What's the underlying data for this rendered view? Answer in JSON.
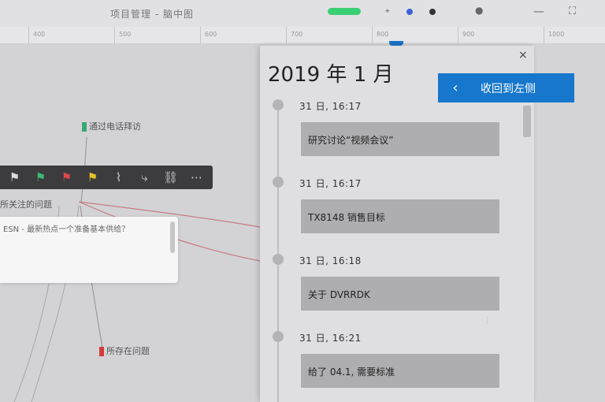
{
  "window": {
    "title": "项目管理 - 脑中图",
    "status_color": "#3bcf73",
    "controls": [
      "minimize",
      "restore"
    ]
  },
  "ruler": {
    "labels": [
      "400",
      "500",
      "600",
      "700",
      "800",
      "900",
      "1000"
    ]
  },
  "mindmap": {
    "nodes": [
      {
        "label": "通过电话拜访",
        "marker_color": "#3aa873"
      },
      {
        "label": "所关注的问题",
        "marker_color": ""
      },
      {
        "label": "所存在问题",
        "marker_color": "#d33c3c"
      }
    ],
    "toolbar": [
      "flag-white",
      "flag-green",
      "flag-red",
      "flag-yellow",
      "chart",
      "branch",
      "link",
      "more"
    ],
    "note_text": "ESN - 最新热点一个准备基本供给？"
  },
  "history_panel": {
    "title": "2019 年 1 月",
    "back_label": "收回到左侧",
    "close_glyph": "×",
    "accent_color": "#1677cc",
    "entries": [
      {
        "time": "31 日, 16:17",
        "text": "研究讨论“视频会议”"
      },
      {
        "time": "31 日, 16:17",
        "text": "TX8148 销售目标"
      },
      {
        "time": "31 日, 16:18",
        "text": "关于 DVRRDK"
      },
      {
        "time": "31 日, 16:21",
        "text": "给了 04.1, 需要标准"
      }
    ]
  }
}
